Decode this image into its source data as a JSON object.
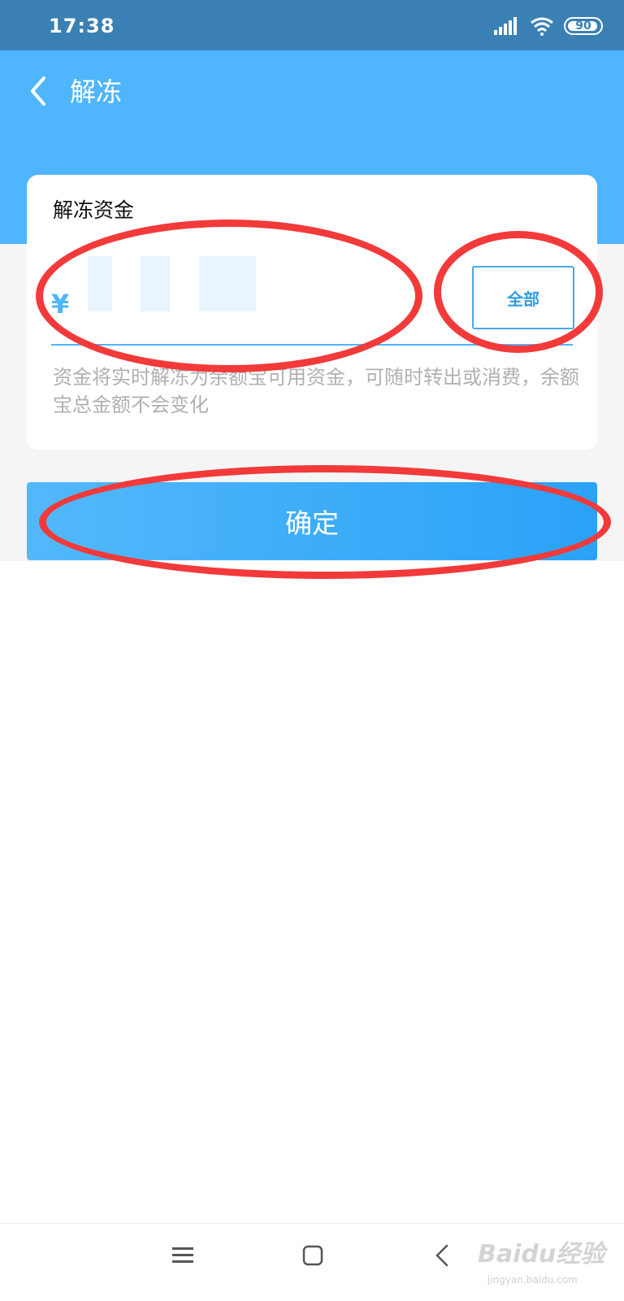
{
  "status_bar": {
    "time": "17:38",
    "battery": "90"
  },
  "header": {
    "title": "解冻"
  },
  "card": {
    "title": "解冻资金",
    "currency_symbol": "¥",
    "amount_value": "",
    "all_button_label": "全部",
    "hint": "资金将实时解冻为余额宝可用资金，可随时转出或消费，余额宝总金额不会变化"
  },
  "confirm_button_label": "确定",
  "watermark": {
    "logo": "Baidu经验",
    "sub": "jingyan.baidu.com"
  },
  "colors": {
    "status_bar": "#3b80b4",
    "header": "#4fb5fd",
    "accent": "#2aa2f7",
    "annotation": "#f23a3a"
  }
}
